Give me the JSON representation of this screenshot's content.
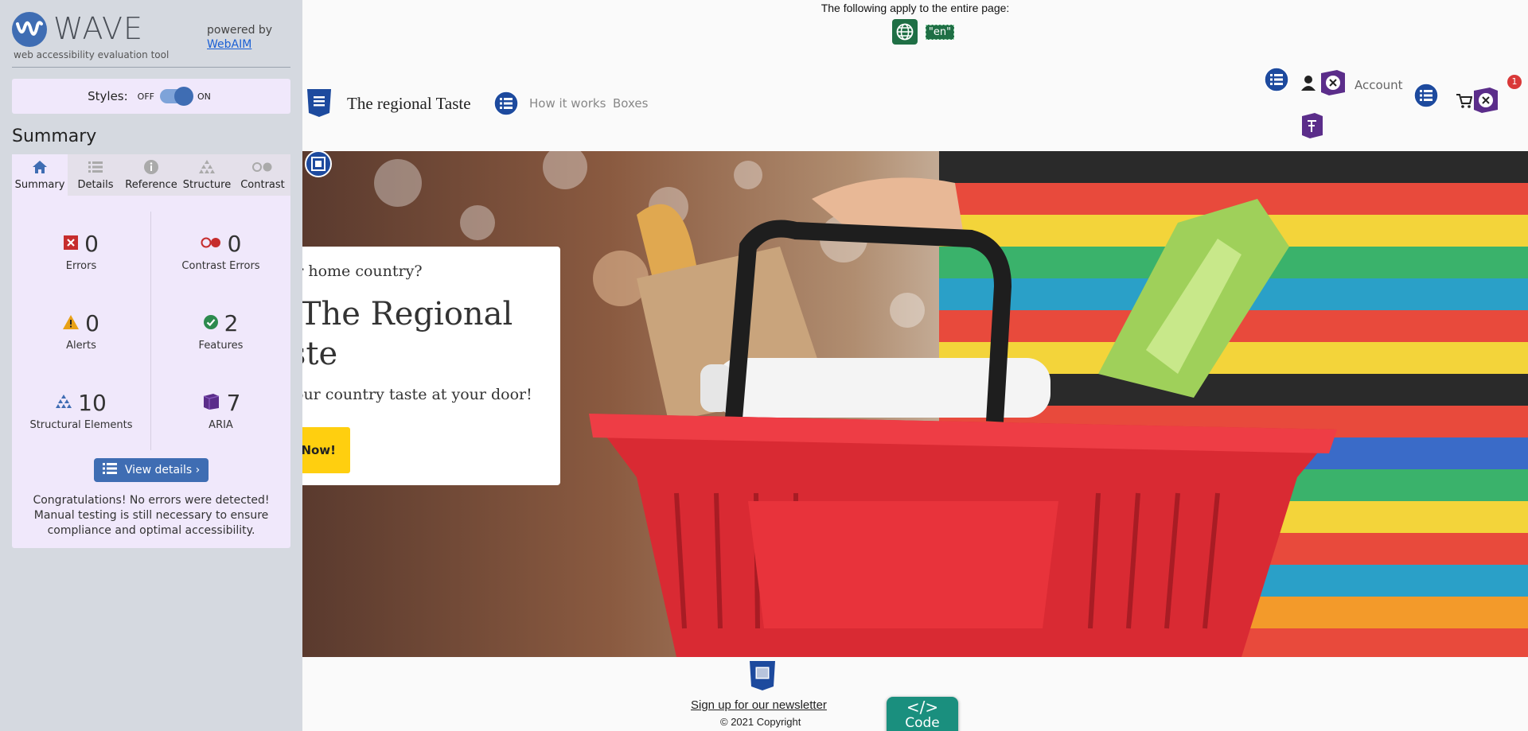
{
  "wave": {
    "title": "WAVE",
    "tagline": "web accessibility evaluation tool",
    "powered_by": "powered by",
    "webaim_link": "WebAIM",
    "styles_label": "Styles:",
    "styles_off": "OFF",
    "styles_on": "ON",
    "section_title": "Summary",
    "tabs": [
      {
        "label": "Summary",
        "icon": "home-icon",
        "active": true
      },
      {
        "label": "Details",
        "icon": "list-icon",
        "active": false
      },
      {
        "label": "Reference",
        "icon": "info-icon",
        "active": false
      },
      {
        "label": "Structure",
        "icon": "structure-icon",
        "active": false
      },
      {
        "label": "Contrast",
        "icon": "contrast-icon",
        "active": false
      }
    ],
    "stats": {
      "errors": {
        "count": "0",
        "label": "Errors"
      },
      "contrast_errors": {
        "count": "0",
        "label": "Contrast Errors"
      },
      "alerts": {
        "count": "0",
        "label": "Alerts"
      },
      "features": {
        "count": "2",
        "label": "Features"
      },
      "structural": {
        "count": "10",
        "label": "Structural Elements"
      },
      "aria": {
        "count": "7",
        "label": "ARIA"
      }
    },
    "view_details": "View details ›",
    "congrats": "Congratulations! No errors were detected! Manual testing is still necessary to ensure compliance and optimal accessibility."
  },
  "page": {
    "applies_text": "The following apply to the entire page:",
    "lang_code": "\"en\"",
    "brand": "The regional Taste",
    "nav": [
      "How it works",
      "Boxes"
    ],
    "account": "Account",
    "cart_count": "1",
    "hero": {
      "question": "ur home country?",
      "heading_line1": "o The Regional",
      "heading_line2": "aste",
      "subtitle": "our country taste at your door!",
      "cta": "Now!"
    },
    "newsletter": "Sign up for our newsletter",
    "copyright": "© 2021 Copyright",
    "code_tab": "Code"
  },
  "colors": {
    "wave_blue": "#3f6db3",
    "panel_bg": "#f0e8fb",
    "error_red": "#c62d2d",
    "alert_orange": "#e8a117",
    "feature_green": "#2d8a4e",
    "aria_purple": "#5b2d8a",
    "cta_yellow": "#ffcf0f"
  }
}
